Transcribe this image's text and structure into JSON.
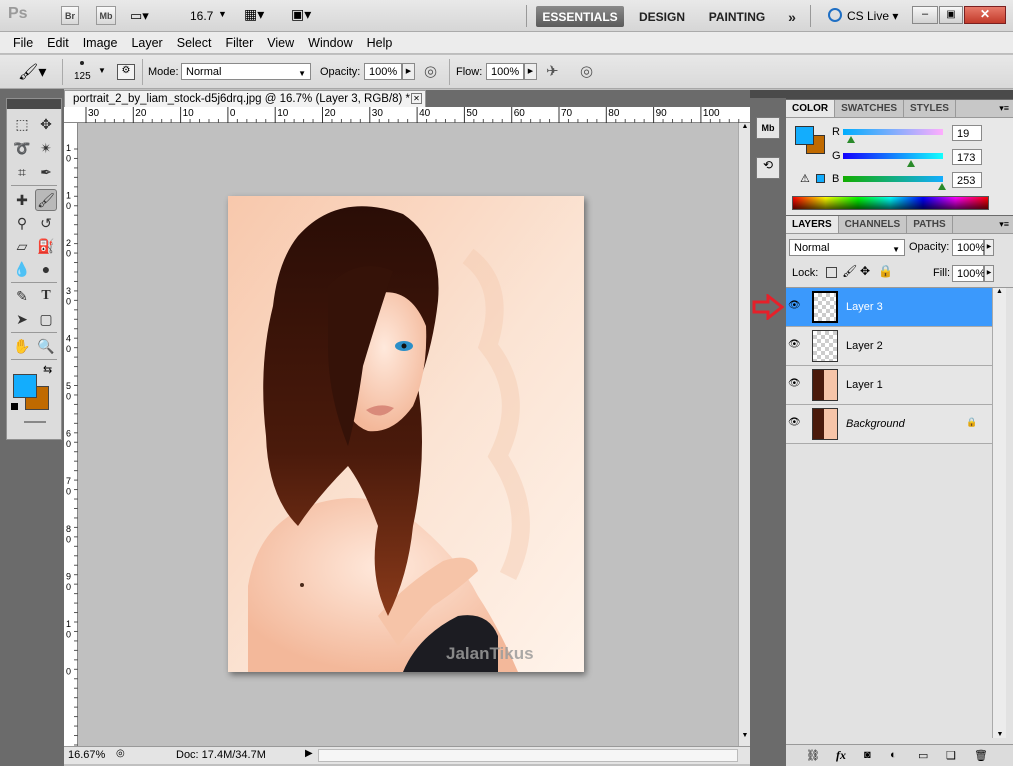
{
  "topbar": {
    "zoom": "16.7",
    "br_label": "Br",
    "mb_label": "Mb",
    "workspaces": [
      "ESSENTIALS",
      "DESIGN",
      "PAINTING"
    ],
    "more": "»",
    "cslive": "CS Live"
  },
  "menu": [
    "File",
    "Edit",
    "Image",
    "Layer",
    "Select",
    "Filter",
    "View",
    "Window",
    "Help"
  ],
  "options": {
    "brush_size": "125",
    "mode_label": "Mode:",
    "mode_value": "Normal",
    "opacity_label": "Opacity:",
    "opacity_value": "100%",
    "flow_label": "Flow:",
    "flow_value": "100%"
  },
  "document": {
    "tab_title": "portrait_2_by_liam_stock-d5j6drq.jpg @ 16.7% (Layer 3, RGB/8) *",
    "ruler_top": [
      "30",
      "20",
      "10",
      "0",
      "10",
      "20",
      "30",
      "40",
      "50",
      "60",
      "70",
      "80",
      "90",
      "100"
    ],
    "ruler_left": [
      "1",
      "0",
      "1",
      "0",
      "2",
      "0",
      "3",
      "0",
      "4",
      "0",
      "5",
      "0",
      "6",
      "0",
      "7",
      "0",
      "8",
      "0",
      "9",
      "0",
      "1",
      "0",
      "0"
    ],
    "watermark": "JalanTikus",
    "zoom_status": "16.67%",
    "doc_size": "Doc: 17.4M/34.7M"
  },
  "colors": {
    "foreground": "#13adfd",
    "background": "#c06a00",
    "highlight": "#3b99fc",
    "arrow": "#e5202a"
  },
  "color_panel": {
    "tabs": [
      "COLOR",
      "SWATCHES",
      "STYLES"
    ],
    "r_label": "R",
    "r_value": "19",
    "g_label": "G",
    "g_value": "173",
    "b_label": "B",
    "b_value": "253",
    "r_level": 0.075,
    "g_level": 0.678,
    "b_level": 0.992
  },
  "layers_panel": {
    "tabs": [
      "LAYERS",
      "CHANNELS",
      "PATHS"
    ],
    "blend_mode": "Normal",
    "opacity_label": "Opacity:",
    "opacity_value": "100%",
    "lock_label": "Lock:",
    "fill_label": "Fill:",
    "fill_value": "100%",
    "layers": [
      {
        "name": "Layer 3"
      },
      {
        "name": "Layer 2"
      },
      {
        "name": "Layer 1"
      },
      {
        "name": "Background"
      }
    ]
  },
  "icons": [
    "ps-logo",
    "hand-icon",
    "zoom-icon",
    "brush-icon",
    "eye-icon",
    "lock-icon",
    "link-icon",
    "fx-icon",
    "mask-icon",
    "adjustment-icon",
    "folder-icon",
    "new-layer-icon",
    "trash-icon",
    "cslive-icon"
  ]
}
